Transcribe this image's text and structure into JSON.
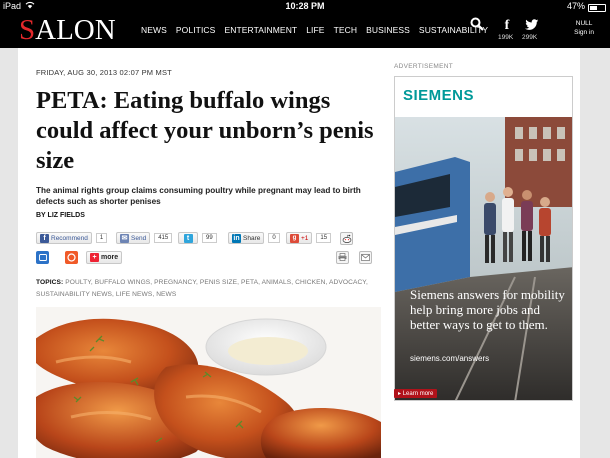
{
  "status": {
    "left": "iPad",
    "time": "10:28 PM",
    "battery": "47%",
    "battery_level": 0.47
  },
  "header": {
    "logo_first": "S",
    "logo_rest": "ALON",
    "nav": [
      "NEWS",
      "POLITICS",
      "ENTERTAINMENT",
      "LIFE",
      "TECH",
      "BUSINESS",
      "SUSTAINABILITY"
    ],
    "facebook_count": "199K",
    "twitter_count": "299K",
    "user": "NULL",
    "signin": "Sign in"
  },
  "article": {
    "dateline": "FRIDAY, AUG 30, 2013 02:07 PM MST",
    "headline": "PETA: Eating buffalo wings could affect your unborn’s penis size",
    "dek": "The animal rights group claims consuming poultry while pregnant may lead to birth defects such as shorter penises",
    "byline": "BY LIZ FIELDS",
    "share": {
      "recommend": "Recommend",
      "recommend_count": "1",
      "send": "Send",
      "send_count": "415",
      "tweet_count": "99",
      "linkedin": "Share",
      "linkedin_count": "0",
      "gplus": "+1",
      "gplus_count": "15",
      "more": "more"
    },
    "topics_label": "TOPICS:",
    "topics": "POULTY, BUFFALO WINGS, PREGNANCY, PENIS SIZE, PETA, ANIMALS, CHICKEN, ADVOCACY, SUSTAINABILITY NEWS, LIFE NEWS, NEWS"
  },
  "sidebar": {
    "ad_label": "ADVERTISEMENT",
    "brand": "SIEMENS",
    "copy": "Siemens answers for mobility help bring more jobs and better ways to get to them.",
    "url": "siemens.com/answers",
    "learn_more": "Learn more"
  },
  "colors": {
    "brand_red": "#e3282b",
    "siemens_teal": "#009999",
    "header_bg": "#000000"
  }
}
